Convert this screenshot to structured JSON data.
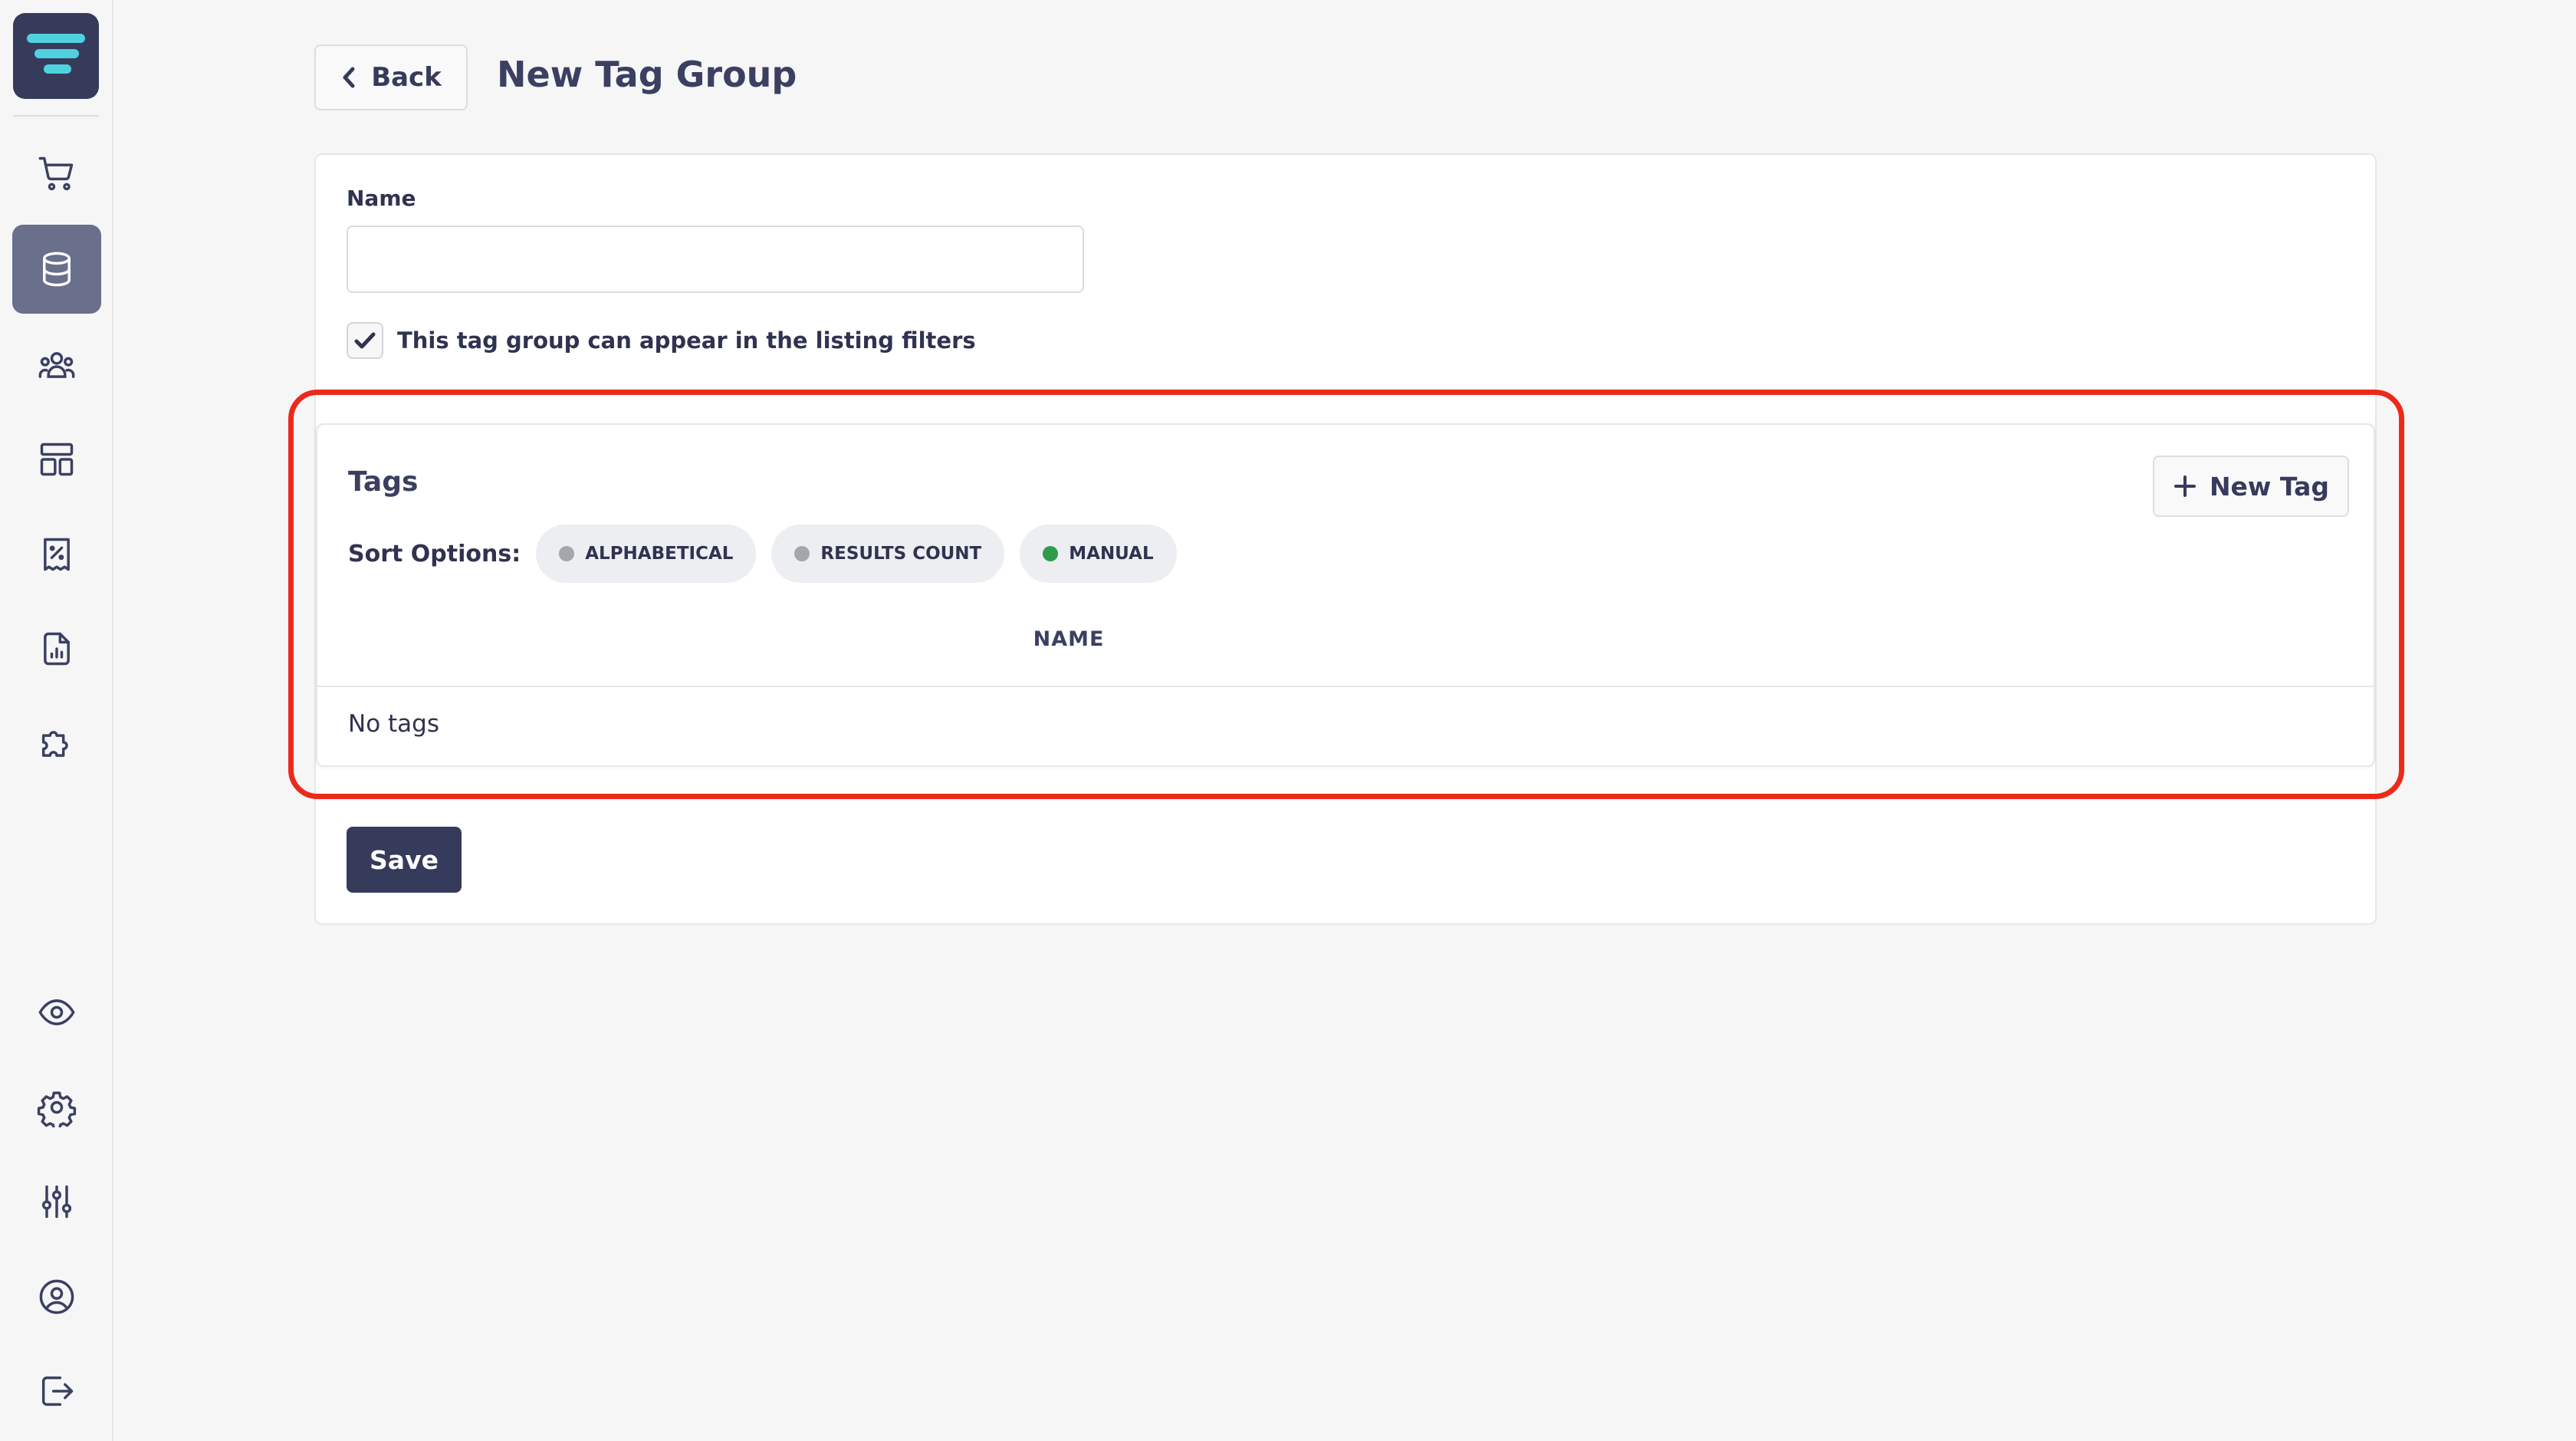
{
  "header": {
    "back_label": "Back",
    "title": "New Tag Group"
  },
  "form": {
    "name_label": "Name",
    "name_value": "",
    "name_placeholder": "",
    "filter_checkbox_label": "This tag group can appear in the listing filters",
    "filter_checkbox_checked": true
  },
  "tags": {
    "title": "Tags",
    "new_tag_label": "New Tag",
    "sort_label": "Sort Options:",
    "sort_options": [
      {
        "label": "ALPHABETICAL",
        "selected": false
      },
      {
        "label": "RESULTS COUNT",
        "selected": false
      },
      {
        "label": "MANUAL",
        "selected": true
      }
    ],
    "column_header": "NAME",
    "empty_text": "No tags"
  },
  "footer": {
    "save_label": "Save"
  },
  "colors": {
    "primary": "#363b5c",
    "selected_dot": "#2f9b4b",
    "unselected_dot": "#a4a6ad",
    "highlight": "#ec2a1a"
  },
  "sidebar": {
    "items": [
      {
        "icon": "cart-icon",
        "active": false
      },
      {
        "icon": "database-icon",
        "active": true
      },
      {
        "icon": "users-icon",
        "active": false
      },
      {
        "icon": "layout-icon",
        "active": false
      },
      {
        "icon": "receipt-discount-icon",
        "active": false
      },
      {
        "icon": "report-icon",
        "active": false
      },
      {
        "icon": "puzzle-icon",
        "active": false
      },
      {
        "icon": "eye-icon",
        "active": false
      },
      {
        "icon": "gear-icon",
        "active": false
      },
      {
        "icon": "sliders-icon",
        "active": false
      },
      {
        "icon": "user-circle-icon",
        "active": false
      },
      {
        "icon": "logout-icon",
        "active": false
      }
    ]
  }
}
